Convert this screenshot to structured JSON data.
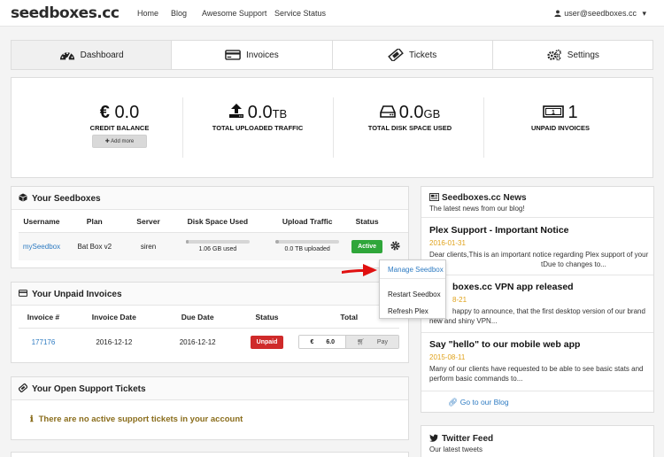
{
  "header": {
    "logo": "seedboxes.cc",
    "nav": [
      "Home",
      "Blog",
      "Awesome Support",
      "Service Status"
    ],
    "user_email": "user@seedboxes.cc",
    "user_caret": "▾"
  },
  "tabs": [
    {
      "label": "Dashboard",
      "icon": "dashboard-icon",
      "active": true
    },
    {
      "label": "Invoices",
      "icon": "credit-card-icon",
      "active": false
    },
    {
      "label": "Tickets",
      "icon": "ticket-icon",
      "active": false
    },
    {
      "label": "Settings",
      "icon": "gears-icon",
      "active": false
    }
  ],
  "stats": {
    "credit": {
      "symbol": "€",
      "value": "0.0",
      "label": "CREDIT BALANCE",
      "button": "Add more"
    },
    "uploaded": {
      "value": "0.0",
      "unit": "TB",
      "label": "TOTAL UPLOADED TRAFFIC"
    },
    "disk": {
      "value": "0.0",
      "unit": "GB",
      "label": "TOTAL DISK SPACE USED"
    },
    "unpaid": {
      "value": "1",
      "label": "UNPAID INVOICES"
    }
  },
  "seedboxes": {
    "title": "Your Seedboxes",
    "columns": [
      "Username",
      "Plan",
      "Server",
      "Disk Space Used",
      "Upload Traffic",
      "Status"
    ],
    "row": {
      "username": "mySeedbox",
      "plan": "Bat Box v2",
      "server": "siren",
      "disk_used": "1.06 GB used",
      "disk_fraction": 0.05,
      "upload": "0.0 TB uploaded",
      "upload_fraction": 0.05,
      "status": "Active"
    },
    "menu": [
      "Manage Seedbox",
      "Restart Seedbox",
      "Refresh Plex"
    ]
  },
  "invoices": {
    "title": "Your Unpaid Invoices",
    "columns": [
      "Invoice #",
      "Invoice Date",
      "Due Date",
      "Status",
      "Total"
    ],
    "row": {
      "number": "177176",
      "invoice_date": "2016-12-12",
      "due_date": "2016-12-12",
      "status": "Unpaid",
      "currency": "€",
      "total": "6.0",
      "pay_label": "Pay"
    }
  },
  "tickets": {
    "title": "Your Open Support Tickets",
    "empty": "There are no active support tickets in your account"
  },
  "news": {
    "title": "Seedboxes.cc News",
    "subtitle": "The latest news from our blog!",
    "items": [
      {
        "title": "Plex Support - Important Notice",
        "date": "2016-01-31",
        "excerpt1": "Dear clients,This is an important notice regarding Plex support of your",
        "excerpt2": "tDue to changes to..."
      },
      {
        "title": "boxes.cc VPN app released",
        "date": "8-21",
        "excerpt1": "happy to announce, that the first desktop version of our brand",
        "excerpt2": "new and shiny VPN..."
      },
      {
        "title": "Say \"hello\" to our mobile web app",
        "date": "2015-08-11",
        "excerpt1": "Many of our clients have requested to be able to see basic stats and",
        "excerpt2": "perform basic commands to..."
      }
    ],
    "blog_link": "Go to our Blog"
  },
  "twitter": {
    "title": "Twitter Feed",
    "subtitle": "Our latest tweets"
  },
  "colors": {
    "link": "#2e7bc2",
    "active": "#2fa63a",
    "unpaid": "#cf2a2a",
    "date": "#e0a21b",
    "pointer_arrow": "#e01010"
  }
}
